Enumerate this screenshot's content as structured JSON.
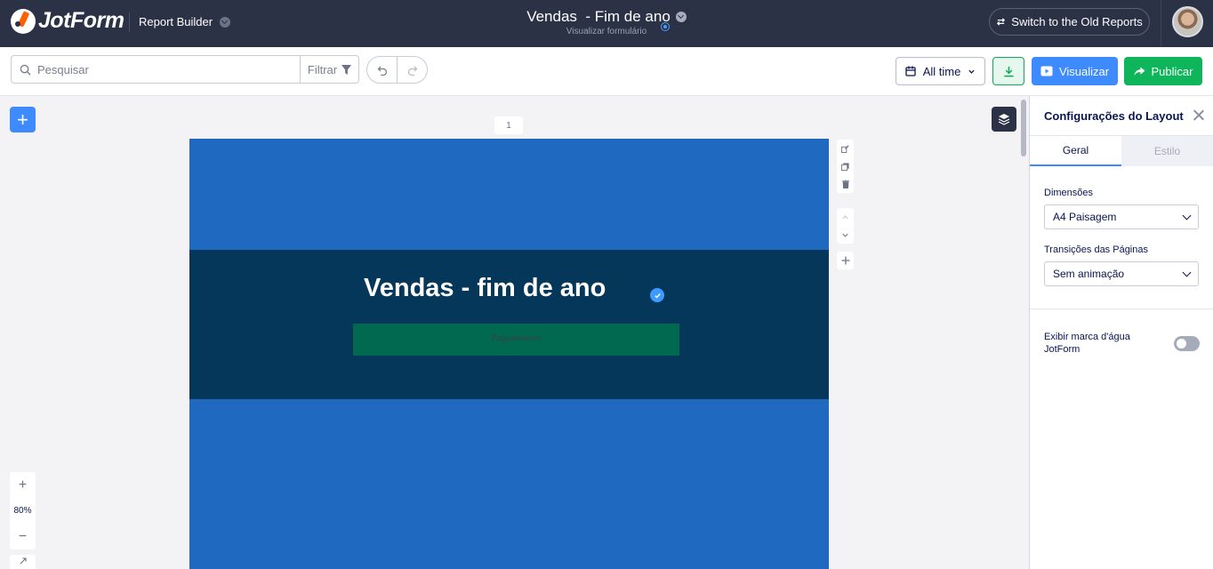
{
  "header": {
    "logo_text": "JotForm",
    "app_name": "Report Builder",
    "report_title": "Vendas  - Fim de ano",
    "report_subtitle": "Visualizar formulário",
    "old_reports_label": "Switch to the Old Reports"
  },
  "toolbar": {
    "search_placeholder": "Pesquisar",
    "filter_label": "Filtrar",
    "date_range": "All time",
    "preview_label": "Visualizar",
    "publish_label": "Publicar"
  },
  "canvas": {
    "page_number": "1",
    "zoom_level": "80%",
    "zoom_in": "+",
    "zoom_out": "−",
    "add_button": "+"
  },
  "report_page": {
    "title": "Vendas - fim de ano",
    "subtitle": "Pagamentos",
    "colors": {
      "background": "#1f69c0",
      "band": "#05375a",
      "subtitle_box": "#00694f"
    }
  },
  "panel": {
    "title": "Configurações do Layout",
    "tabs": [
      {
        "label": "Geral",
        "active": true
      },
      {
        "label": "Estilo",
        "active": false
      }
    ],
    "dimensions_label": "Dimensões",
    "dimensions_value": "A4 Paisagem",
    "transitions_label": "Transições das Páginas",
    "transitions_value": "Sem animação",
    "watermark_label": "Exibir marca d'água JotForm",
    "watermark_enabled": false
  },
  "colors": {
    "navbar": "#2b3245",
    "primary_blue": "#3d8bff",
    "publish_green": "#0fb55a"
  }
}
